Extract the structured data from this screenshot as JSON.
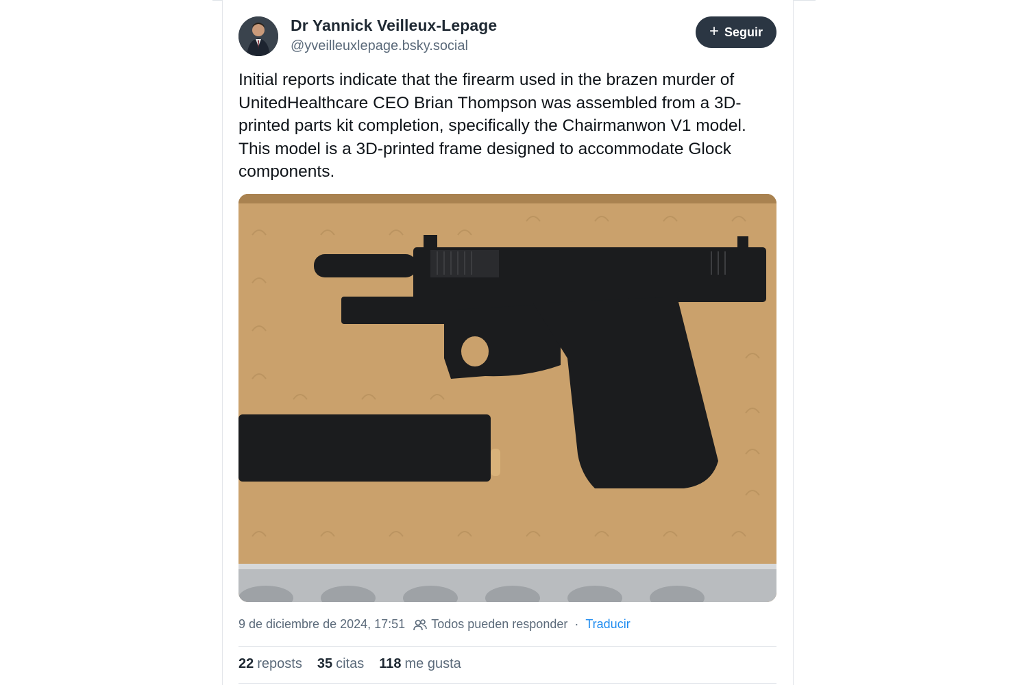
{
  "author": {
    "name": "Dr Yannick Veilleux-Lepage",
    "handle": "@yveilleuxlepage.bsky.social",
    "avatar_icon": "avatar-photo"
  },
  "follow_button": {
    "icon": "plus-icon",
    "icon_glyph": "+",
    "label": "Seguir"
  },
  "post": {
    "text": "Initial reports indicate that the firearm used in the brazen murder of UnitedHealthcare CEO Brian Thompson was assembled from a 3D-printed parts kit completion, specifically the Chairmanwon V1 model. This model is a 3D-printed frame designed to accommodate Glock components."
  },
  "meta": {
    "timestamp": "9 de diciembre de 2024, 17:51",
    "reply_icon": "people-icon",
    "reply_setting": "Todos pueden responder",
    "separator": "·",
    "translate_label": "Traducir"
  },
  "stats": {
    "reposts_count": "22",
    "reposts_label": "reposts",
    "quotes_count": "35",
    "quotes_label": "citas",
    "likes_count": "118",
    "likes_label": "me gusta"
  },
  "colors": {
    "follow_bg": "#2b3643",
    "link": "#1f8cf0",
    "muted_text": "#5b6a7a",
    "cardboard": "#c9a06a"
  }
}
